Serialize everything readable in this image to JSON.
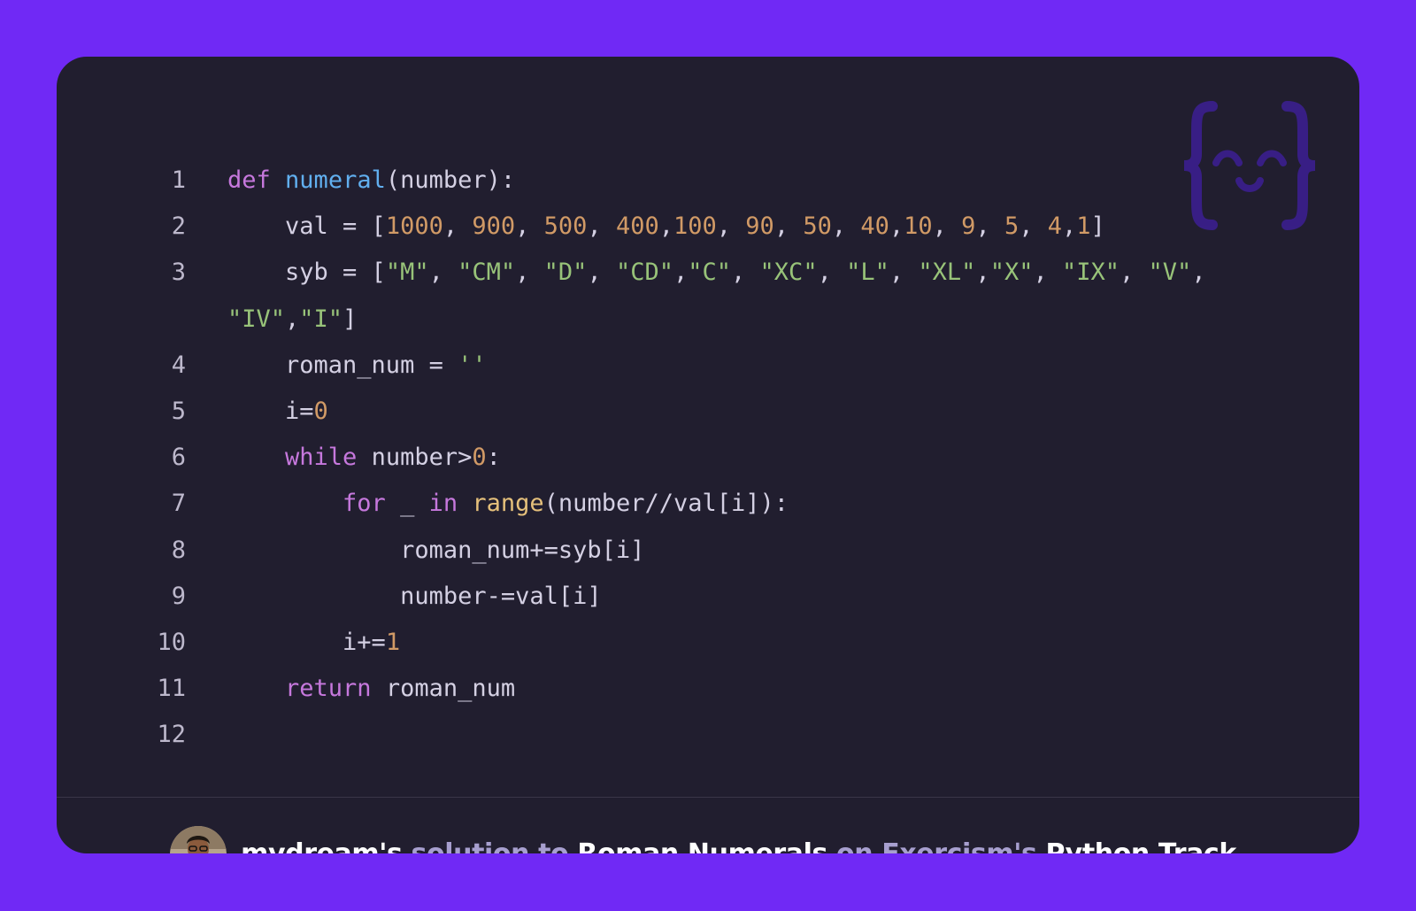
{
  "code": {
    "lines": [
      {
        "number": "1",
        "tokens": [
          {
            "text": "def",
            "type": "kw"
          },
          {
            "text": " ",
            "type": "default"
          },
          {
            "text": "numeral",
            "type": "fn"
          },
          {
            "text": "(number):",
            "type": "default"
          }
        ]
      },
      {
        "number": "2",
        "tokens": [
          {
            "text": "    val = [",
            "type": "default"
          },
          {
            "text": "1000",
            "type": "num"
          },
          {
            "text": ", ",
            "type": "default"
          },
          {
            "text": "900",
            "type": "num"
          },
          {
            "text": ", ",
            "type": "default"
          },
          {
            "text": "500",
            "type": "num"
          },
          {
            "text": ", ",
            "type": "default"
          },
          {
            "text": "400",
            "type": "num"
          },
          {
            "text": ",",
            "type": "default"
          },
          {
            "text": "100",
            "type": "num"
          },
          {
            "text": ", ",
            "type": "default"
          },
          {
            "text": "90",
            "type": "num"
          },
          {
            "text": ", ",
            "type": "default"
          },
          {
            "text": "50",
            "type": "num"
          },
          {
            "text": ", ",
            "type": "default"
          },
          {
            "text": "40",
            "type": "num"
          },
          {
            "text": ",",
            "type": "default"
          },
          {
            "text": "10",
            "type": "num"
          },
          {
            "text": ", ",
            "type": "default"
          },
          {
            "text": "9",
            "type": "num"
          },
          {
            "text": ", ",
            "type": "default"
          },
          {
            "text": "5",
            "type": "num"
          },
          {
            "text": ", ",
            "type": "default"
          },
          {
            "text": "4",
            "type": "num"
          },
          {
            "text": ",",
            "type": "default"
          },
          {
            "text": "1",
            "type": "num"
          },
          {
            "text": "]",
            "type": "default"
          }
        ]
      },
      {
        "number": "3",
        "tokens": [
          {
            "text": "    syb = [",
            "type": "default"
          },
          {
            "text": "\"M\"",
            "type": "str"
          },
          {
            "text": ", ",
            "type": "default"
          },
          {
            "text": "\"CM\"",
            "type": "str"
          },
          {
            "text": ", ",
            "type": "default"
          },
          {
            "text": "\"D\"",
            "type": "str"
          },
          {
            "text": ", ",
            "type": "default"
          },
          {
            "text": "\"CD\"",
            "type": "str"
          },
          {
            "text": ",",
            "type": "default"
          },
          {
            "text": "\"C\"",
            "type": "str"
          },
          {
            "text": ", ",
            "type": "default"
          },
          {
            "text": "\"XC\"",
            "type": "str"
          },
          {
            "text": ", ",
            "type": "default"
          },
          {
            "text": "\"L\"",
            "type": "str"
          },
          {
            "text": ", ",
            "type": "default"
          },
          {
            "text": "\"XL\"",
            "type": "str"
          },
          {
            "text": ",",
            "type": "default"
          },
          {
            "text": "\"X\"",
            "type": "str"
          },
          {
            "text": ", ",
            "type": "default"
          },
          {
            "text": "\"IX\"",
            "type": "str"
          },
          {
            "text": ", ",
            "type": "default"
          },
          {
            "text": "\"V\"",
            "type": "str"
          },
          {
            "text": ",",
            "type": "default"
          }
        ]
      },
      {
        "number": "",
        "tokens": [
          {
            "text": "\"IV\"",
            "type": "str"
          },
          {
            "text": ",",
            "type": "default"
          },
          {
            "text": "\"I\"",
            "type": "str"
          },
          {
            "text": "]",
            "type": "default"
          }
        ]
      },
      {
        "number": "4",
        "tokens": [
          {
            "text": "    roman_num = ",
            "type": "default"
          },
          {
            "text": "''",
            "type": "str"
          }
        ]
      },
      {
        "number": "5",
        "tokens": [
          {
            "text": "    i=",
            "type": "default"
          },
          {
            "text": "0",
            "type": "num"
          }
        ]
      },
      {
        "number": "6",
        "tokens": [
          {
            "text": "    ",
            "type": "default"
          },
          {
            "text": "while",
            "type": "kw"
          },
          {
            "text": " number>",
            "type": "default"
          },
          {
            "text": "0",
            "type": "num"
          },
          {
            "text": ":",
            "type": "default"
          }
        ]
      },
      {
        "number": "7",
        "tokens": [
          {
            "text": "        ",
            "type": "default"
          },
          {
            "text": "for",
            "type": "kw"
          },
          {
            "text": " _ ",
            "type": "default"
          },
          {
            "text": "in",
            "type": "kw"
          },
          {
            "text": " ",
            "type": "default"
          },
          {
            "text": "range",
            "type": "builtin"
          },
          {
            "text": "(number//val[i]):",
            "type": "default"
          }
        ]
      },
      {
        "number": "8",
        "tokens": [
          {
            "text": "            roman_num+=syb[i]",
            "type": "default"
          }
        ]
      },
      {
        "number": "9",
        "tokens": [
          {
            "text": "            number-=val[i]",
            "type": "default"
          }
        ]
      },
      {
        "number": "10",
        "tokens": [
          {
            "text": "        i+=",
            "type": "default"
          },
          {
            "text": "1",
            "type": "num"
          }
        ]
      },
      {
        "number": "11",
        "tokens": [
          {
            "text": "    ",
            "type": "default"
          },
          {
            "text": "return",
            "type": "kw"
          },
          {
            "text": " roman_num",
            "type": "default"
          }
        ]
      },
      {
        "number": "12",
        "tokens": []
      }
    ]
  },
  "footer": {
    "user": "mvdream's",
    "solution_to": " solution to ",
    "exercise": "Roman Numerals",
    "on": " on ",
    "site": "Exercism's",
    "track": " Python Track."
  },
  "colors": {
    "background": "#7029f5",
    "card": "#211e2f",
    "keyword": "#c678dd",
    "function": "#61afef",
    "number": "#d19a66",
    "string": "#98c379",
    "builtin": "#e5c07b"
  },
  "icons": {
    "logo": "exercism-logo-icon",
    "avatar": "user-avatar"
  }
}
